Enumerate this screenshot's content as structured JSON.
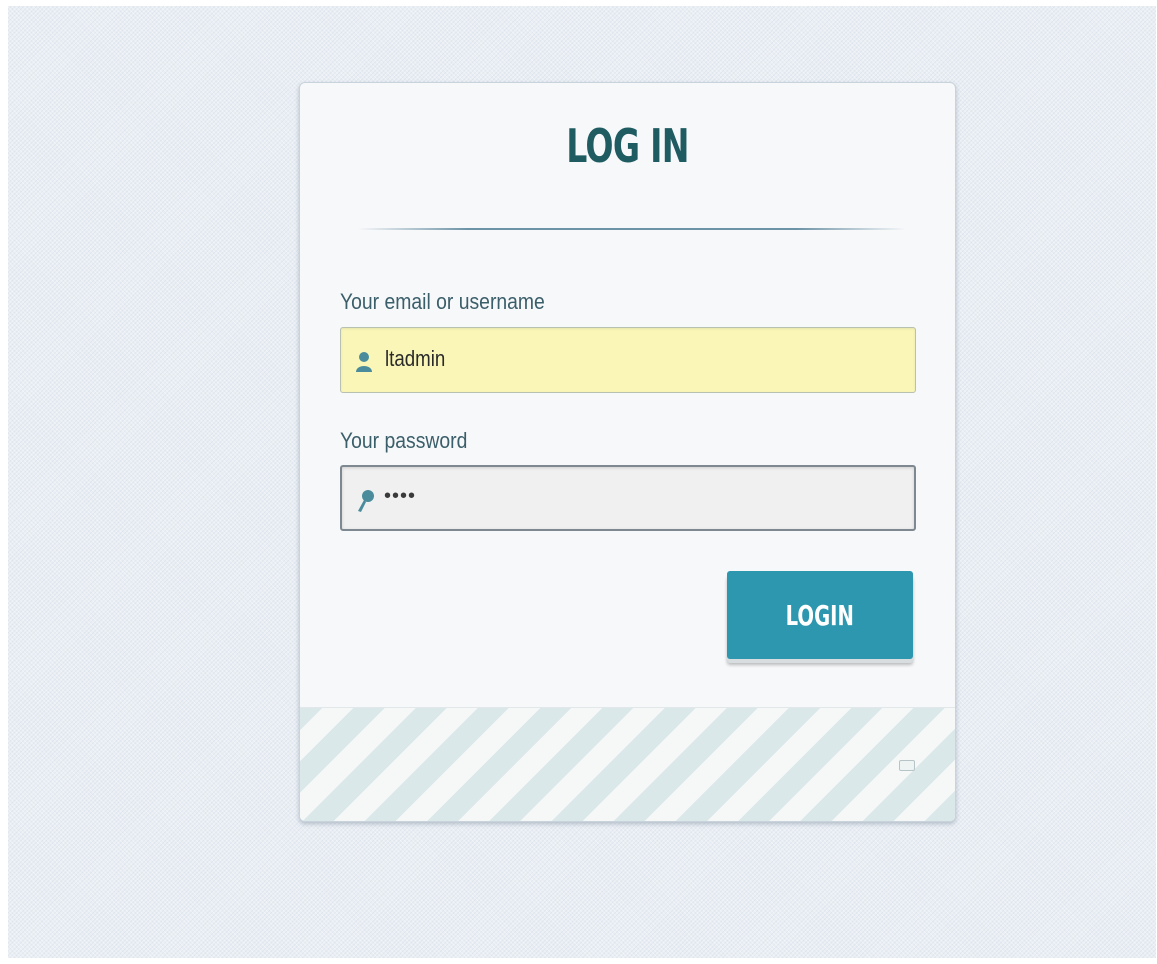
{
  "login": {
    "title": "LOG IN",
    "email_label": "Your email or username",
    "email_value": "ltadmin",
    "password_label": "Your password",
    "password_value": "••••",
    "button_label": "LOGIN"
  },
  "icons": {
    "email": "user-icon",
    "password": "key-icon"
  },
  "colors": {
    "title": "#1f5c61",
    "button": "#2c97ae",
    "email_field_bg": "#f9f6b8",
    "stripe": "#dbe8ea"
  }
}
